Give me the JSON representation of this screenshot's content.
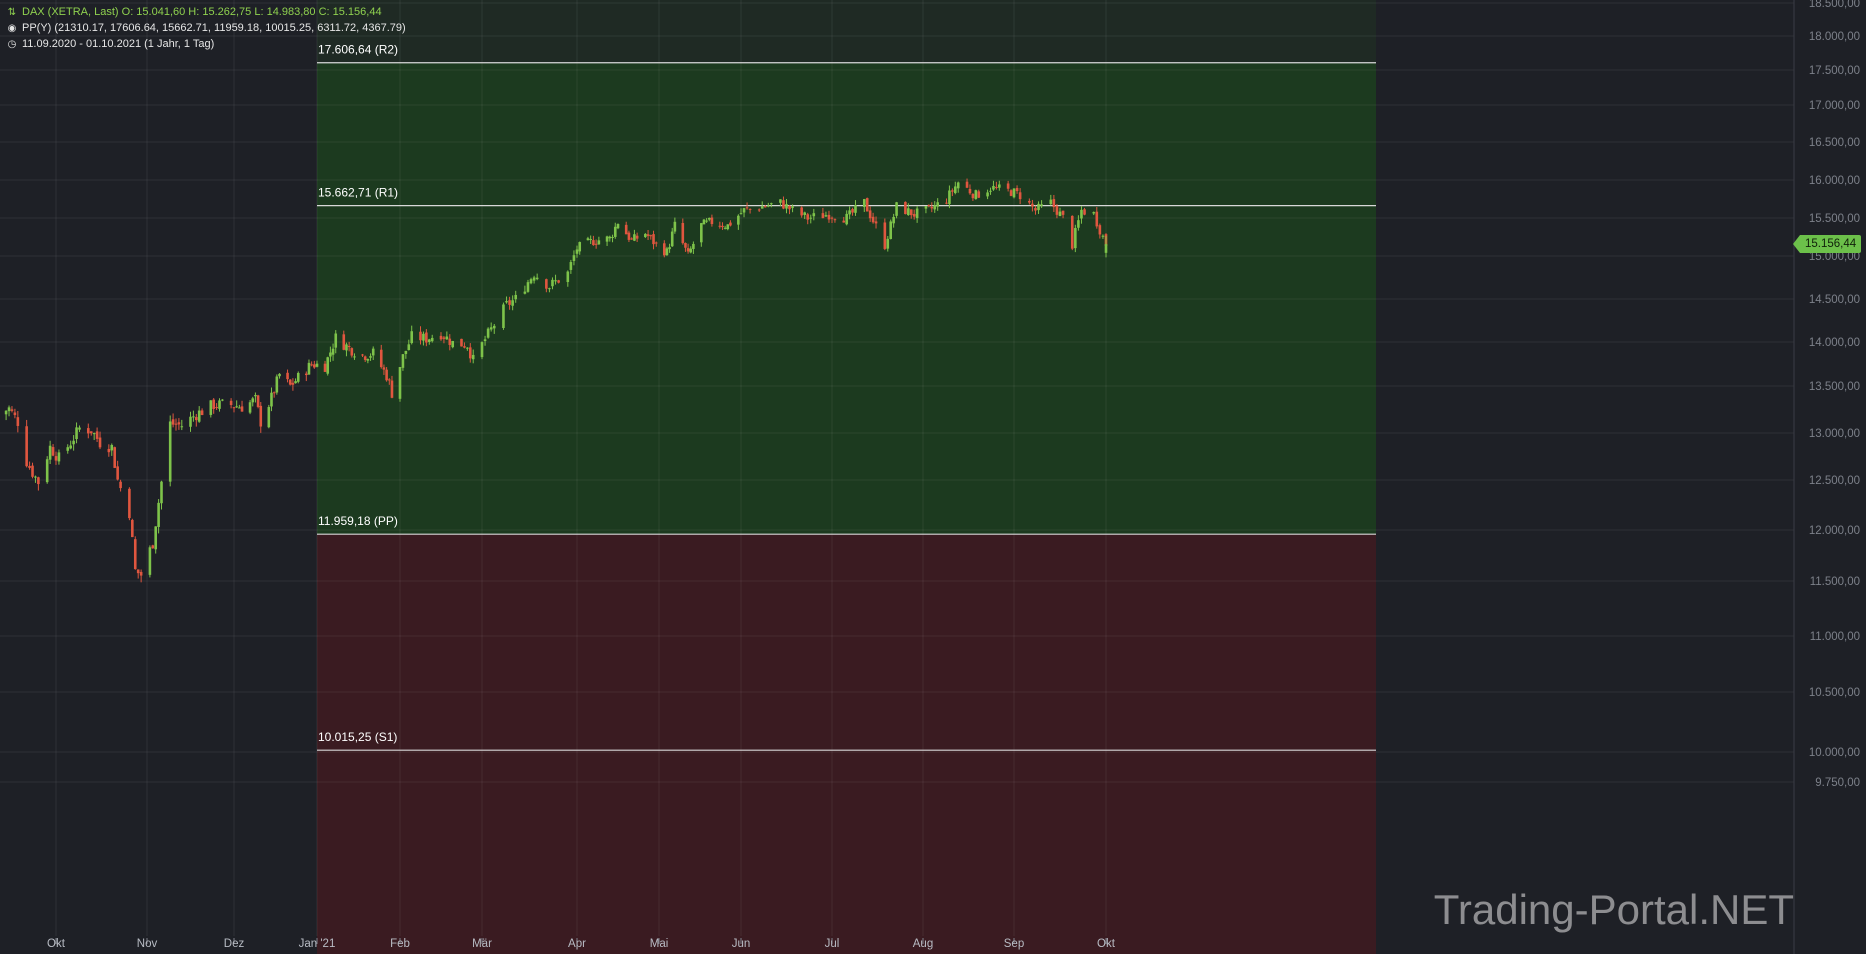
{
  "header": {
    "line1": "DAX (XETRA, Last)  O: 15.041,60  H: 15.262,75  L: 14.983,80  C: 15.156,44",
    "line2": "PP(Y)  (21310.17, 17606.64, 15662.71, 11959.18, 10015.25, 6311.72, 4367.79)",
    "line3": "11.09.2020 - 01.10.2021   (1 Jahr, 1 Tag)",
    "icon1": "chart-logo-icon",
    "icon2": "target-icon",
    "icon3": "clock-icon"
  },
  "watermark": "Trading-Portal.NET",
  "colors": {
    "background": "#1e2026",
    "up": "#7ec34a",
    "down": "#e0563f",
    "above_pp_zone": "#1c3a1f",
    "below_pp_zone": "#3a1b21",
    "last_price_tag": "#6cc04a"
  },
  "chart_data": {
    "type": "candlestick",
    "title": "DAX (XETRA, Last)",
    "last_price_label": "15.156,44",
    "last_price": 15156.44,
    "y_axis_labels": [
      "18.500,00",
      "18.000,00",
      "17.500,00",
      "17.000,00",
      "16.500,00",
      "16.000,00",
      "15.500,00",
      "15.000,00",
      "14.500,00",
      "14.000,00",
      "13.500,00",
      "13.000,00",
      "12.500,00",
      "12.000,00",
      "11.500,00",
      "11.000,00",
      "10.500,00",
      "10.000,00",
      "9.750,00"
    ],
    "y_axis_values": [
      18500,
      18000,
      17500,
      17000,
      16500,
      16000,
      15500,
      15000,
      14500,
      14000,
      13500,
      13000,
      12500,
      12000,
      11500,
      11000,
      10500,
      10000,
      9750
    ],
    "x_axis_labels": [
      "Okt",
      "Nov",
      "Dez",
      "Jan '21",
      "Feb",
      "Mär",
      "Apr",
      "Mai",
      "Jun",
      "Jul",
      "Aug",
      "Sep",
      "Okt"
    ],
    "x_axis_dates": [
      "2020-10-01",
      "2020-11-01",
      "2020-12-01",
      "2021-01-01",
      "2021-02-01",
      "2021-03-01",
      "2021-04-01",
      "2021-05-01",
      "2021-06-01",
      "2021-07-01",
      "2021-08-01",
      "2021-09-01",
      "2021-10-01"
    ],
    "date_range": [
      "2020-09-11",
      "2021-10-01"
    ],
    "pivot_levels": [
      {
        "name": "R2",
        "value": 17606.64,
        "label": "17.606,64 (R2)"
      },
      {
        "name": "R1",
        "value": 15662.71,
        "label": "15.662,71 (R1)"
      },
      {
        "name": "PP",
        "value": 11959.18,
        "label": "11.959,18 (PP)"
      },
      {
        "name": "S1",
        "value": 10015.25,
        "label": "10.015,25 (S1)"
      }
    ],
    "pivot_zone_start": "2021-01-01",
    "pivot_zone_end": "2021-12-31",
    "close_series": [
      [
        "2020-09-11",
        13200
      ],
      [
        "2020-09-15",
        13260
      ],
      [
        "2020-09-18",
        13120
      ],
      [
        "2020-09-21",
        12700
      ],
      [
        "2020-09-23",
        12580
      ],
      [
        "2020-09-25",
        12480
      ],
      [
        "2020-09-29",
        12850
      ],
      [
        "2020-10-02",
        12730
      ],
      [
        "2020-10-06",
        12900
      ],
      [
        "2020-10-09",
        13050
      ],
      [
        "2020-10-13",
        13030
      ],
      [
        "2020-10-16",
        12900
      ],
      [
        "2020-10-20",
        12850
      ],
      [
        "2020-10-22",
        12500
      ],
      [
        "2020-10-26",
        12180
      ],
      [
        "2020-10-28",
        11600
      ],
      [
        "2020-10-30",
        11560
      ],
      [
        "2020-11-03",
        11880
      ],
      [
        "2020-11-06",
        12480
      ],
      [
        "2020-11-09",
        13100
      ],
      [
        "2020-11-13",
        13080
      ],
      [
        "2020-11-18",
        13200
      ],
      [
        "2020-11-24",
        13300
      ],
      [
        "2020-11-30",
        13300
      ],
      [
        "2020-12-04",
        13280
      ],
      [
        "2020-12-09",
        13350
      ],
      [
        "2020-12-11",
        13120
      ],
      [
        "2020-12-15",
        13370
      ],
      [
        "2020-12-18",
        13630
      ],
      [
        "2020-12-22",
        13500
      ],
      [
        "2020-12-30",
        13750
      ],
      [
        "2021-01-04",
        13730
      ],
      [
        "2021-01-08",
        14050
      ],
      [
        "2021-01-13",
        13930
      ],
      [
        "2021-01-18",
        13850
      ],
      [
        "2021-01-22",
        13870
      ],
      [
        "2021-01-27",
        13620
      ],
      [
        "2021-01-29",
        13430
      ],
      [
        "2021-02-02",
        13830
      ],
      [
        "2021-02-05",
        14060
      ],
      [
        "2021-02-10",
        14040
      ],
      [
        "2021-02-15",
        14100
      ],
      [
        "2021-02-19",
        13990
      ],
      [
        "2021-02-24",
        13970
      ],
      [
        "2021-02-26",
        13790
      ],
      [
        "2021-03-03",
        14090
      ],
      [
        "2021-03-09",
        14430
      ],
      [
        "2021-03-12",
        14500
      ],
      [
        "2021-03-18",
        14800
      ],
      [
        "2021-03-23",
        14650
      ],
      [
        "2021-03-29",
        14800
      ],
      [
        "2021-04-01",
        15100
      ],
      [
        "2021-04-07",
        15200
      ],
      [
        "2021-04-13",
        15230
      ],
      [
        "2021-04-16",
        15450
      ],
      [
        "2021-04-21",
        15200
      ],
      [
        "2021-04-26",
        15300
      ],
      [
        "2021-04-30",
        15150
      ],
      [
        "2021-05-04",
        15050
      ],
      [
        "2021-05-07",
        15400
      ],
      [
        "2021-05-12",
        15000
      ],
      [
        "2021-05-17",
        15400
      ],
      [
        "2021-05-21",
        15450
      ],
      [
        "2021-05-27",
        15400
      ],
      [
        "2021-06-02",
        15600
      ],
      [
        "2021-06-08",
        15650
      ],
      [
        "2021-06-14",
        15700
      ],
      [
        "2021-06-18",
        15600
      ],
      [
        "2021-06-23",
        15500
      ],
      [
        "2021-06-30",
        15550
      ],
      [
        "2021-07-06",
        15500
      ],
      [
        "2021-07-12",
        15700
      ],
      [
        "2021-07-19",
        15150
      ],
      [
        "2021-07-23",
        15650
      ],
      [
        "2021-07-29",
        15550
      ],
      [
        "2021-08-03",
        15600
      ],
      [
        "2021-08-09",
        15750
      ],
      [
        "2021-08-13",
        15970
      ],
      [
        "2021-08-19",
        15800
      ],
      [
        "2021-08-24",
        15900
      ],
      [
        "2021-08-31",
        15850
      ],
      [
        "2021-09-03",
        15800
      ],
      [
        "2021-09-08",
        15600
      ],
      [
        "2021-09-13",
        15700
      ],
      [
        "2021-09-17",
        15500
      ],
      [
        "2021-09-20",
        15150
      ],
      [
        "2021-09-23",
        15600
      ],
      [
        "2021-09-27",
        15550
      ],
      [
        "2021-09-29",
        15350
      ],
      [
        "2021-10-01",
        15156.44
      ]
    ]
  }
}
